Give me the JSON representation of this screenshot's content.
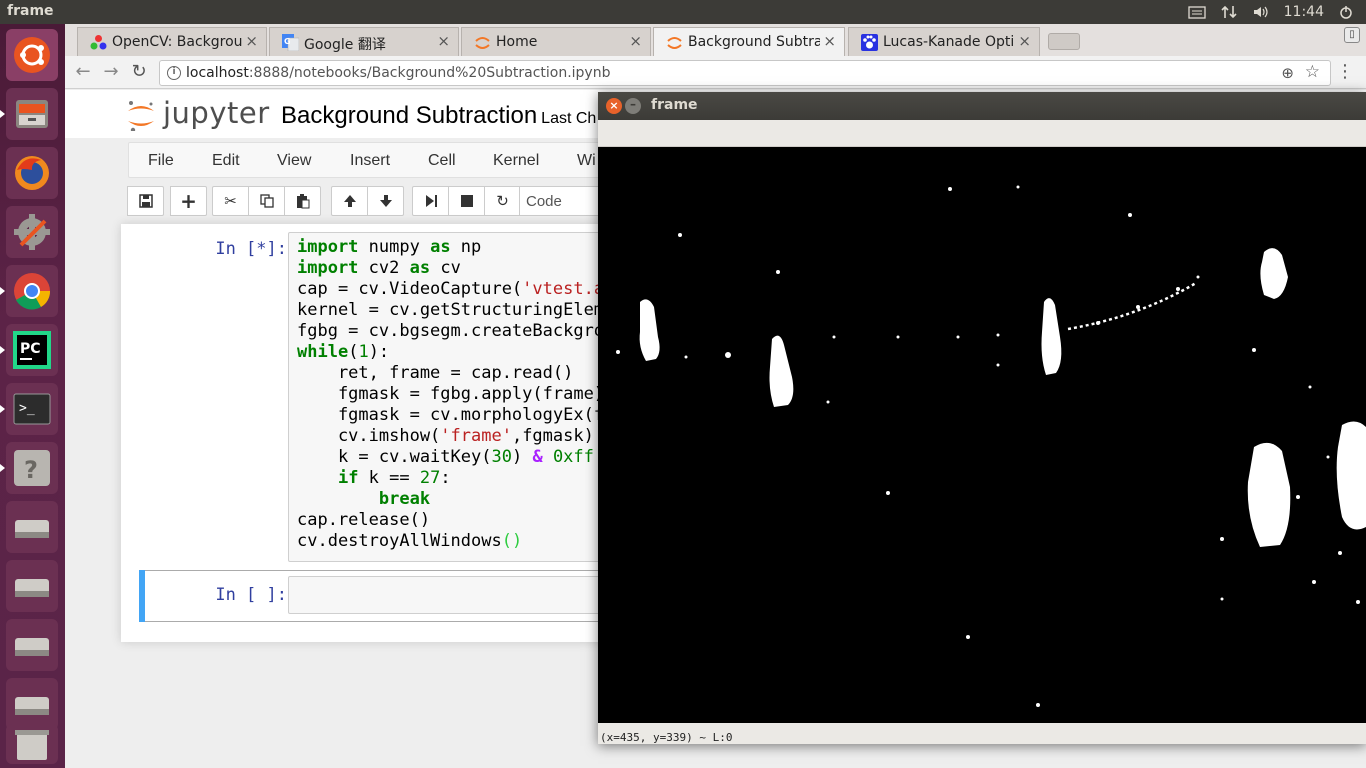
{
  "topbar": {
    "title": "frame",
    "time": "11:44",
    "tray_icons": [
      "keyboard-icon",
      "network-icon",
      "volume-icon"
    ]
  },
  "launcher": {
    "items": [
      "ubuntu-dash",
      "files",
      "firefox",
      "system-settings",
      "chrome",
      "pycharm",
      "terminal",
      "help",
      "drive",
      "drive",
      "drive",
      "drive",
      "trash"
    ]
  },
  "tabs": [
    {
      "label": "OpenCV: Backgrou",
      "icon": "opencv-icon"
    },
    {
      "label": "Google 翻译",
      "icon": "google-translate-icon"
    },
    {
      "label": "Home",
      "icon": "jupyter-icon"
    },
    {
      "label": "Background Subtra",
      "icon": "jupyter-icon"
    },
    {
      "label": "Lucas-Kanade Optic",
      "icon": "baidu-icon"
    }
  ],
  "address": {
    "host": "localhost",
    "path": ":8888/notebooks/Background%20Subtraction.ipynb"
  },
  "jupyter": {
    "logo_text": "jupyter",
    "notebook_title": "Background Subtraction",
    "checkpoint": "Last Ch",
    "menu": [
      "File",
      "Edit",
      "View",
      "Insert",
      "Cell",
      "Kernel",
      "Wi"
    ],
    "cell_type": "Code"
  },
  "cells": [
    {
      "prompt": "In [*]:"
    },
    {
      "prompt": "In [ ]:"
    }
  ],
  "cvwindow": {
    "title": "frame",
    "status": "(x=435, y=339) ~ L:0"
  }
}
